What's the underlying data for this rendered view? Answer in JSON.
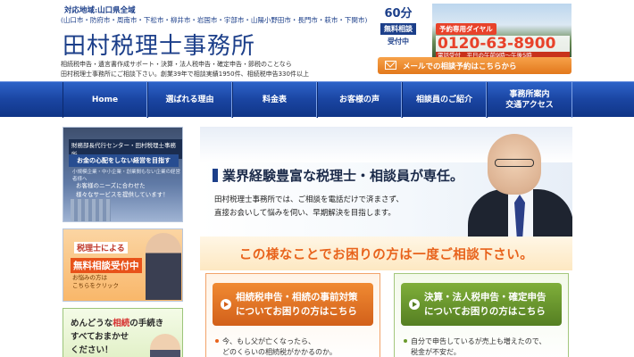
{
  "header": {
    "area_title": "対応地域:山口県全域",
    "area_list": "(山口市・防府市・周南市・下松市・柳井市・岩国市・宇部市・山陽小野田市・長門市・萩市・下関市)",
    "office_name": "田村税理士事務所",
    "services": "相続税申告・遺言書作成サポート・決算・法人税申告・確定申告・節税のことなら",
    "intro": "田村税理士事務所にご相談下さい。創業39年で相談実績1950件、相続税申告330件以上",
    "free_consult": {
      "minutes": "60分",
      "label": "無料相談",
      "accepting": "受付中"
    },
    "phone": {
      "tag": "予約専用ダイヤル",
      "number": "0120-63-8900",
      "hours": "電話受付　平日の午前9時〜午後5時"
    },
    "mail_button": "メールでの相談予約はこちらから"
  },
  "nav": [
    {
      "label": "Home"
    },
    {
      "label": "選ばれる理由"
    },
    {
      "label": "料金表"
    },
    {
      "label": "お客様の声"
    },
    {
      "label": "相談員のご紹介"
    },
    {
      "label": "事務所案内\n交通アクセス"
    }
  ],
  "sidebar": {
    "banner1": {
      "tag": "財務部長代行センター・田村税理士事務所",
      "headline": "お金の心配をしない経営を目指す",
      "sub": "小規模企業・中小企業・創業間もない企業の経営者様へ",
      "text1": "お客様のニーズに合わせた",
      "text2": "様々なサービスを提供しています！"
    },
    "banner2": {
      "line1": "税理士による",
      "line2": "無料相談受付中",
      "line3a": "お悩みの方は",
      "line3b": "こちらをクリック"
    },
    "banner3": {
      "line1_pre": "めんどうな",
      "line1_red": "相続",
      "line1_post": "の手続き",
      "line2": "すべておまかせ",
      "line3": "ください！"
    }
  },
  "hero": {
    "headline": "業界経験豊富な税理士・相談員が専任。",
    "body_line1": "田村税理士事務所では、ご相談を電話だけで済まさず、",
    "body_line2": "直接お会いして悩みを伺い、早期解決を目指します。"
  },
  "trouble_bar": "この様なことでお困りの方は一度ご相談下さい。",
  "categories": [
    {
      "line1": "相続税申告・相続の事前対策",
      "line2": "についてお困りの方はこちら",
      "items": [
        "今、もし父が亡くなったら、",
        "どのくらいの相続税がかかるのか。"
      ]
    },
    {
      "line1": "決算・法人税申告・確定申告",
      "line2": "についてお困りの方はこちら",
      "items": [
        "自分で申告しているが売上も増えたので、",
        "税金が不安だ。"
      ]
    }
  ],
  "colors": {
    "brand_blue": "#1c3f8a",
    "accent_orange": "#e8631c",
    "accent_green": "#6a9a2c"
  }
}
